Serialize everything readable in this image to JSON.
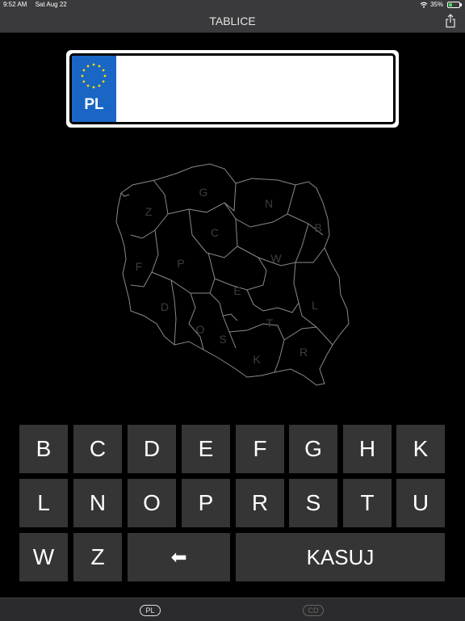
{
  "status": {
    "time": "9:52 AM",
    "date": "Sat Aug 22",
    "battery": "35%"
  },
  "nav": {
    "title": "TABLICE"
  },
  "plate": {
    "country_code": "PL",
    "text": ""
  },
  "map": {
    "regions": [
      {
        "letter": "G"
      },
      {
        "letter": "Z"
      },
      {
        "letter": "N"
      },
      {
        "letter": "B"
      },
      {
        "letter": "C"
      },
      {
        "letter": "F"
      },
      {
        "letter": "P"
      },
      {
        "letter": "W"
      },
      {
        "letter": "E"
      },
      {
        "letter": "L"
      },
      {
        "letter": "D"
      },
      {
        "letter": "O"
      },
      {
        "letter": "S"
      },
      {
        "letter": "T"
      },
      {
        "letter": "K"
      },
      {
        "letter": "R"
      }
    ]
  },
  "keyboard": {
    "row1": [
      "B",
      "C",
      "D",
      "E",
      "F",
      "G",
      "H",
      "K"
    ],
    "row2": [
      "L",
      "N",
      "O",
      "P",
      "R",
      "S",
      "T",
      "U"
    ],
    "row3": {
      "w": "W",
      "z": "Z",
      "backspace": "⬅",
      "clear": "KASUJ"
    }
  },
  "tabs": {
    "pl": "PL",
    "cd": "CD"
  },
  "colors": {
    "accent_eu_blue": "#1a66c5",
    "key_bg": "#353535",
    "bar_bg": "#3a3a3c"
  }
}
